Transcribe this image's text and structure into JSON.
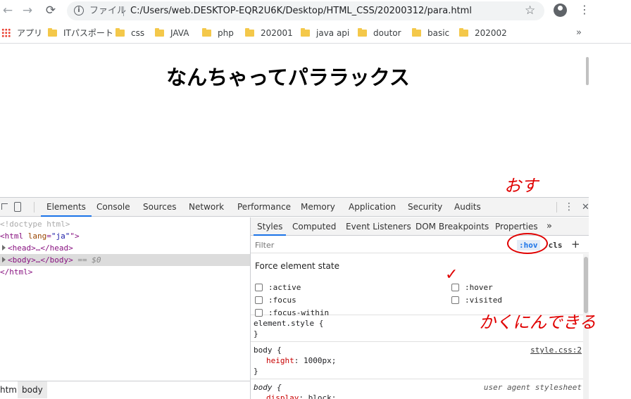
{
  "browser": {
    "url_scheme_label": "ファイル",
    "url": "C:/Users/web.DESKTOP-EQR2U6K/Desktop/HTML_CSS/20200312/para.html"
  },
  "bookmarks": {
    "apps_label": "アプリ",
    "items": [
      "ITパスポート",
      "css",
      "JAVA",
      "php",
      "202001",
      "java api",
      "doutor",
      "basic",
      "202002"
    ],
    "more": "»"
  },
  "page": {
    "title": "なんちゃってパララックス"
  },
  "devtools": {
    "tabs": [
      "Elements",
      "Console",
      "Sources",
      "Network",
      "Performance",
      "Memory",
      "Application",
      "Security",
      "Audits"
    ],
    "active_tab": "Elements",
    "dom": {
      "doctype": "<!doctype html>",
      "html_open_tag": "<html",
      "html_attr": "lang",
      "html_attr_value": "\"ja\"",
      "html_open_end": "\">",
      "head": "<head>…</head>",
      "body": "<body>…</body>",
      "body_suffix": "== $0",
      "html_close": "</html>"
    },
    "breadcrumbs": [
      "html",
      "body"
    ],
    "styles_tabs": [
      "Styles",
      "Computed",
      "Event Listeners",
      "DOM Breakpoints",
      "Properties"
    ],
    "styles_more": "»",
    "filter_placeholder": "Filter",
    "hov_label": ":hov",
    "cls_label": ".cls",
    "add_label": "+",
    "force_state_title": "Force element state",
    "pseudo_states_left": [
      ":active",
      ":focus",
      ":focus-within"
    ],
    "pseudo_states_right": [
      ":hover",
      ":visited"
    ],
    "rules": {
      "element_style_selector": "element.style {",
      "element_style_close": "}",
      "body_selector": "body {",
      "body_source": "style.css:2",
      "body_prop": "height",
      "body_value": "1000px;",
      "body_close": "}",
      "ua_selector": "body {",
      "ua_source": "user agent stylesheet",
      "ua_prop": "display",
      "ua_value": "block;"
    }
  },
  "annotations": {
    "push": "おす",
    "check": "✓",
    "hidden": "かくにんできる"
  }
}
